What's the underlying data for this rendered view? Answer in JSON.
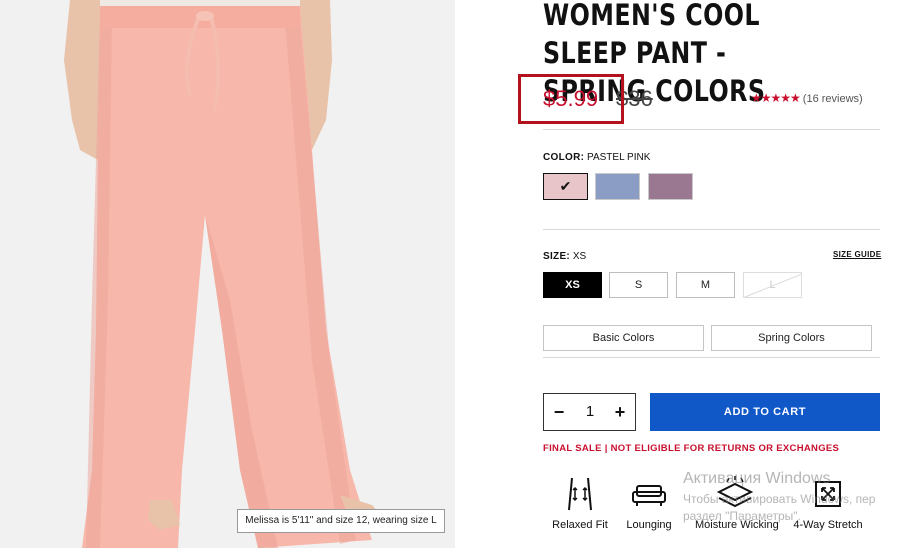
{
  "product": {
    "title": "WOMEN'S COOL SLEEP PANT - SPRING COLORS",
    "price_sale": "$5.99",
    "price_original": "$36",
    "stars": "★★★★★",
    "reviews": "(16 reviews)"
  },
  "image": {
    "caption": "Melissa is 5'11\" and size 12, wearing size L"
  },
  "color": {
    "label": "COLOR:",
    "selected": "PASTEL PINK",
    "swatches": [
      "#e7c5c8",
      "#8b9dc4",
      "#9b7891"
    ]
  },
  "size": {
    "label": "SIZE:",
    "selected": "XS",
    "guide": "SIZE GUIDE",
    "options": [
      "XS",
      "S",
      "M",
      "L"
    ]
  },
  "collections": [
    "Basic Colors",
    "Spring Colors"
  ],
  "quantity": {
    "minus": "−",
    "value": "1",
    "plus": "+"
  },
  "cart": {
    "label": "ADD TO CART"
  },
  "final_sale": "FINAL SALE | NOT ELIGIBLE FOR RETURNS OR EXCHANGES",
  "features": [
    "Relaxed Fit",
    "Lounging",
    "Moisture Wicking",
    "4-Way Stretch"
  ],
  "watermark": {
    "line1": "Активация Windows",
    "line2": "Чтобы активировать Windows, пер",
    "line3": "раздел \"Параметры\"."
  },
  "colors": {
    "sale_red": "#c8102e",
    "cart_blue": "#1057c8",
    "highlight_red": "#b3111b"
  }
}
